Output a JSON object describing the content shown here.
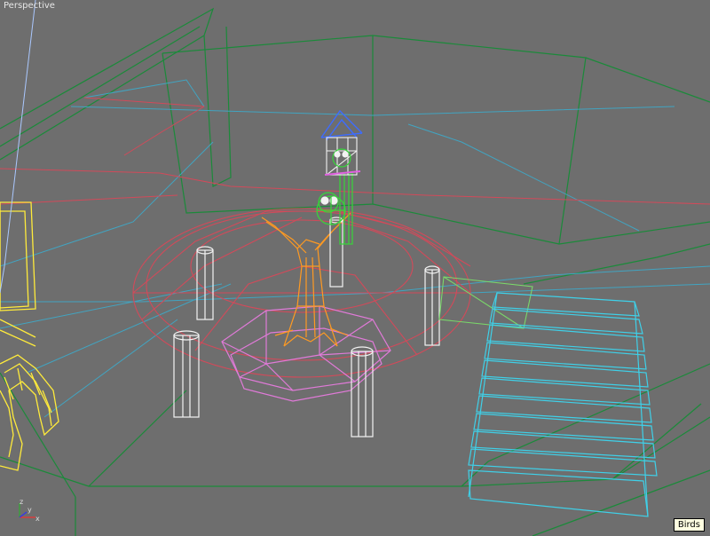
{
  "viewport": {
    "label": "Perspective"
  },
  "tooltip": {
    "text": "Birds"
  },
  "axis": {
    "x": "x",
    "y": "y",
    "z": "z"
  },
  "colors": {
    "background": "#6e6e6e",
    "room": "#1b8a3a",
    "rug": "#d24a5a",
    "stairs": "#3fd0e8",
    "platform": "#e07ad8",
    "tree": "#ff9a22",
    "pillars": "#f2f2f2",
    "bird": "#37d63a",
    "birdhouse": "#3d6cff",
    "furniture": "#ffeb3b",
    "rope": "#aac8ff"
  }
}
